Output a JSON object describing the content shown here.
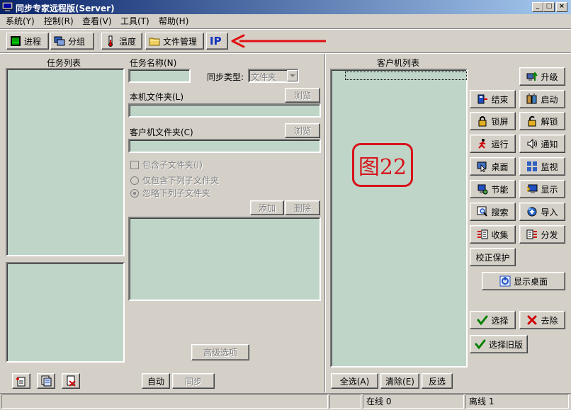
{
  "window": {
    "title": "同步专家远程版(Server)",
    "controls": {
      "minimize": "_",
      "maximize": "□",
      "close": "×"
    }
  },
  "menu": [
    "系统(Y)",
    "控制(R)",
    "查看(V)",
    "工具(T)",
    "帮助(H)"
  ],
  "toolbar": {
    "process": "进程",
    "group": "分组",
    "temperature": "温度",
    "file_manage": "文件管理",
    "ip": "IP"
  },
  "task_list": {
    "header": "任务列表"
  },
  "task_form": {
    "name_label": "任务名称(N)",
    "sync_type_label": "同步类型:",
    "sync_type_value": "文件夹",
    "local_folder_label": "本机文件夹(L)",
    "client_folder_label": "客户机文件夹(C)",
    "browse": "浏览",
    "include_subfolders": "包含子文件夹(I)",
    "only_include": "仅包含下列子文件夹",
    "ignore": "忽略下列子文件夹",
    "add": "添加",
    "delete": "删除",
    "advanced": "高级选项",
    "auto": "自动",
    "sync": "同步"
  },
  "client_list": {
    "header": "客户机列表",
    "select_all": "全选(A)",
    "clear": "清除(E)",
    "invert": "反选"
  },
  "side_buttons": {
    "upgrade": "升级",
    "end": "结束",
    "start": "启动",
    "lock_screen": "锁屏",
    "unlock": "解锁",
    "run": "运行",
    "notify": "通知",
    "desktop": "桌面",
    "monitor": "监视",
    "power_save": "节能",
    "display": "显示",
    "search": "搜索",
    "import": "导入",
    "collect": "收集",
    "distribute": "分发",
    "verify_protect": "校正保护",
    "show_desktop": "显示桌面",
    "select": "选择",
    "remove": "去除",
    "select_old": "选择旧版"
  },
  "annotation": "图22",
  "status": {
    "online": "在线 0",
    "offline": "离线 1"
  },
  "colors": {
    "face": "#d4d0c8",
    "list_bg": "#bed5c8",
    "accent_red": "#d8121a",
    "title_start": "#0a246a"
  }
}
